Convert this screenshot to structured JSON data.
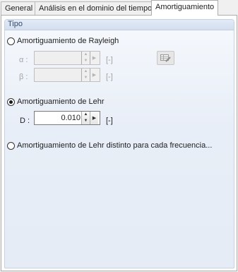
{
  "tabs": [
    {
      "label": "General",
      "active": false
    },
    {
      "label": "Análisis en el dominio del tiempo",
      "active": false
    },
    {
      "label": "Amortiguamiento",
      "active": true
    }
  ],
  "group": {
    "title": "Tipo"
  },
  "rayleigh": {
    "label": "Amortiguamiento de Rayleigh",
    "selected": false,
    "alpha": {
      "label": "α :",
      "value": "",
      "unit": "[-]"
    },
    "beta": {
      "label": "β :",
      "value": "",
      "unit": "[-]"
    },
    "tool_icon": "table-edit-icon"
  },
  "lehr": {
    "label": "Amortiguamiento de Lehr",
    "selected": true,
    "d": {
      "label": "D :",
      "value": "0.010",
      "unit": "[-]"
    }
  },
  "lehr_freq": {
    "label": "Amortiguamiento de Lehr distinto para cada frecuencia...",
    "selected": false
  }
}
